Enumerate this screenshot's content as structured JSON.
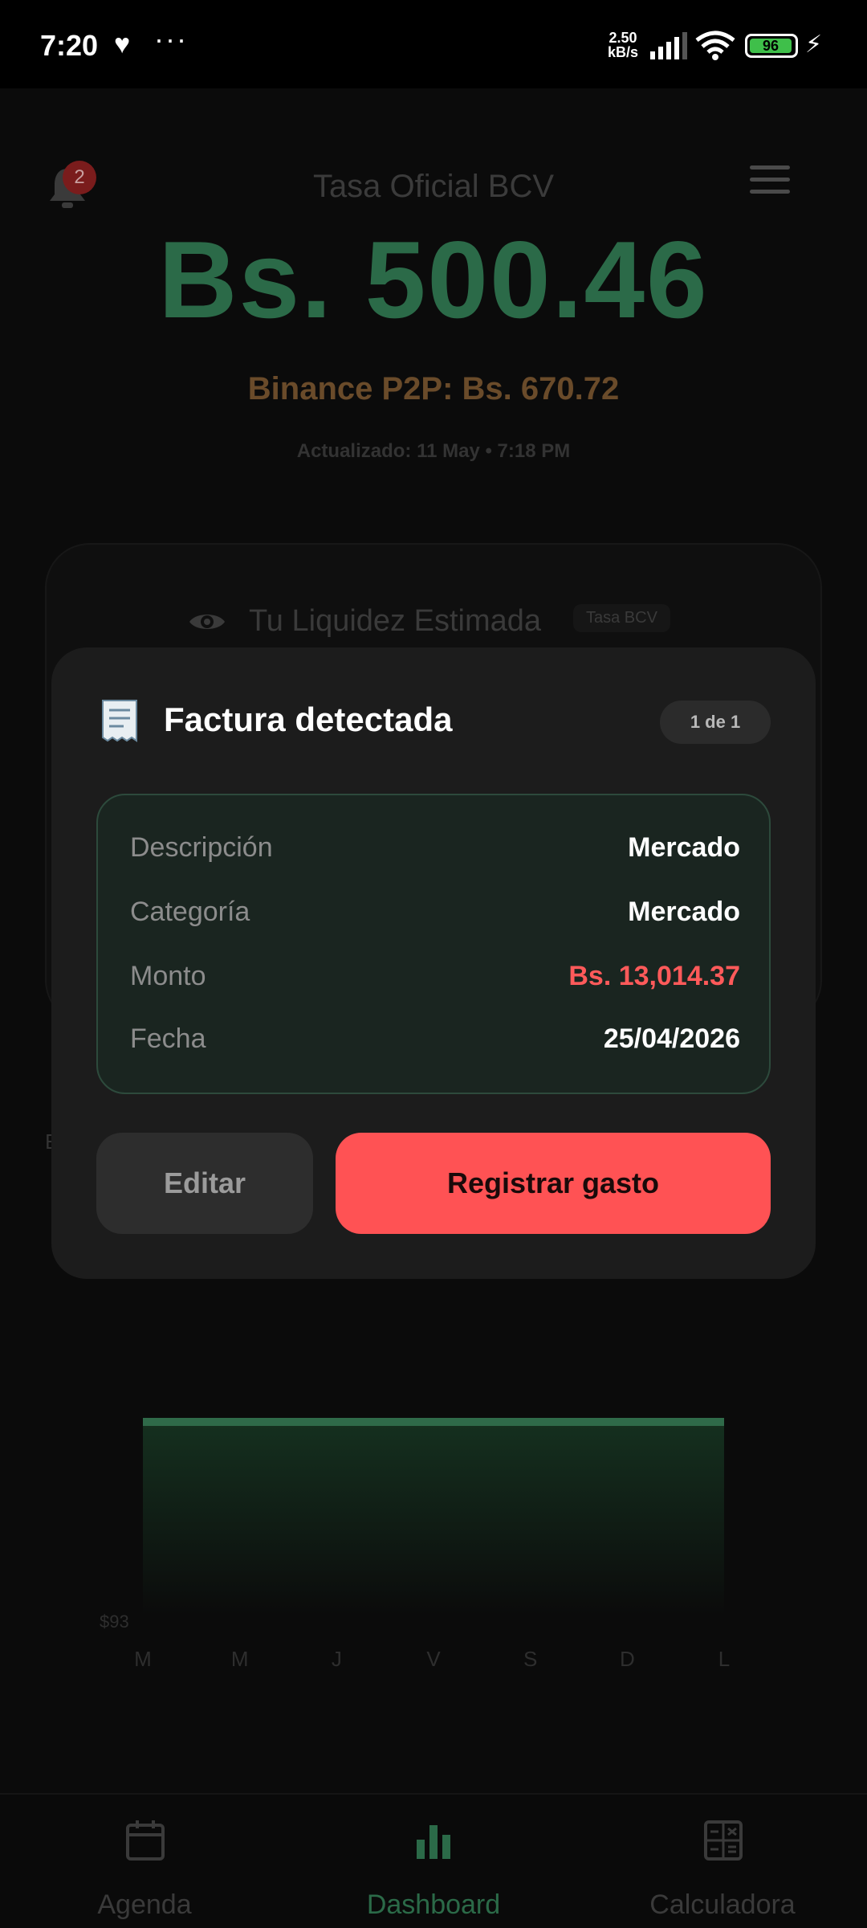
{
  "status_bar": {
    "time": "7:20",
    "speed_value": "2.50",
    "speed_unit": "kB/s",
    "battery": "96",
    "battery_level": 0.96
  },
  "header": {
    "notification_count": "2",
    "rate_label": "Tasa Oficial BCV",
    "rate_value": "Bs. 500.46",
    "binance": "Binance P2P: Bs. 670.72",
    "updated": "Actualizado: 11 May • 7:18 PM"
  },
  "liquidity": {
    "title": "Tu Liquidez Estimada",
    "badge": "Tasa BCV",
    "partial_letter": "E"
  },
  "chart_data": {
    "type": "area",
    "x": [
      "M",
      "M",
      "J",
      "V",
      "S",
      "D",
      "L"
    ],
    "ytick": "$93"
  },
  "modal": {
    "title": "Factura detectada",
    "counter": "1 de 1",
    "rows": [
      {
        "label": "Descripción",
        "value": "Mercado"
      },
      {
        "label": "Categoría",
        "value": "Mercado"
      },
      {
        "label": "Monto",
        "value": "Bs. 13,014.37"
      },
      {
        "label": "Fecha",
        "value": "25/04/2026"
      }
    ],
    "edit_label": "Editar",
    "register_label": "Registrar gasto"
  },
  "bottom_nav": [
    {
      "label": "Agenda",
      "icon": "calendar-icon",
      "active": false
    },
    {
      "label": "Dashboard",
      "icon": "bar-chart-icon",
      "active": true
    },
    {
      "label": "Calculadora",
      "icon": "calculator-icon",
      "active": false
    }
  ],
  "colors": {
    "accent_green": "#2b6a48",
    "danger_red": "#ff5254",
    "amount_red": "#ff5a5a"
  }
}
